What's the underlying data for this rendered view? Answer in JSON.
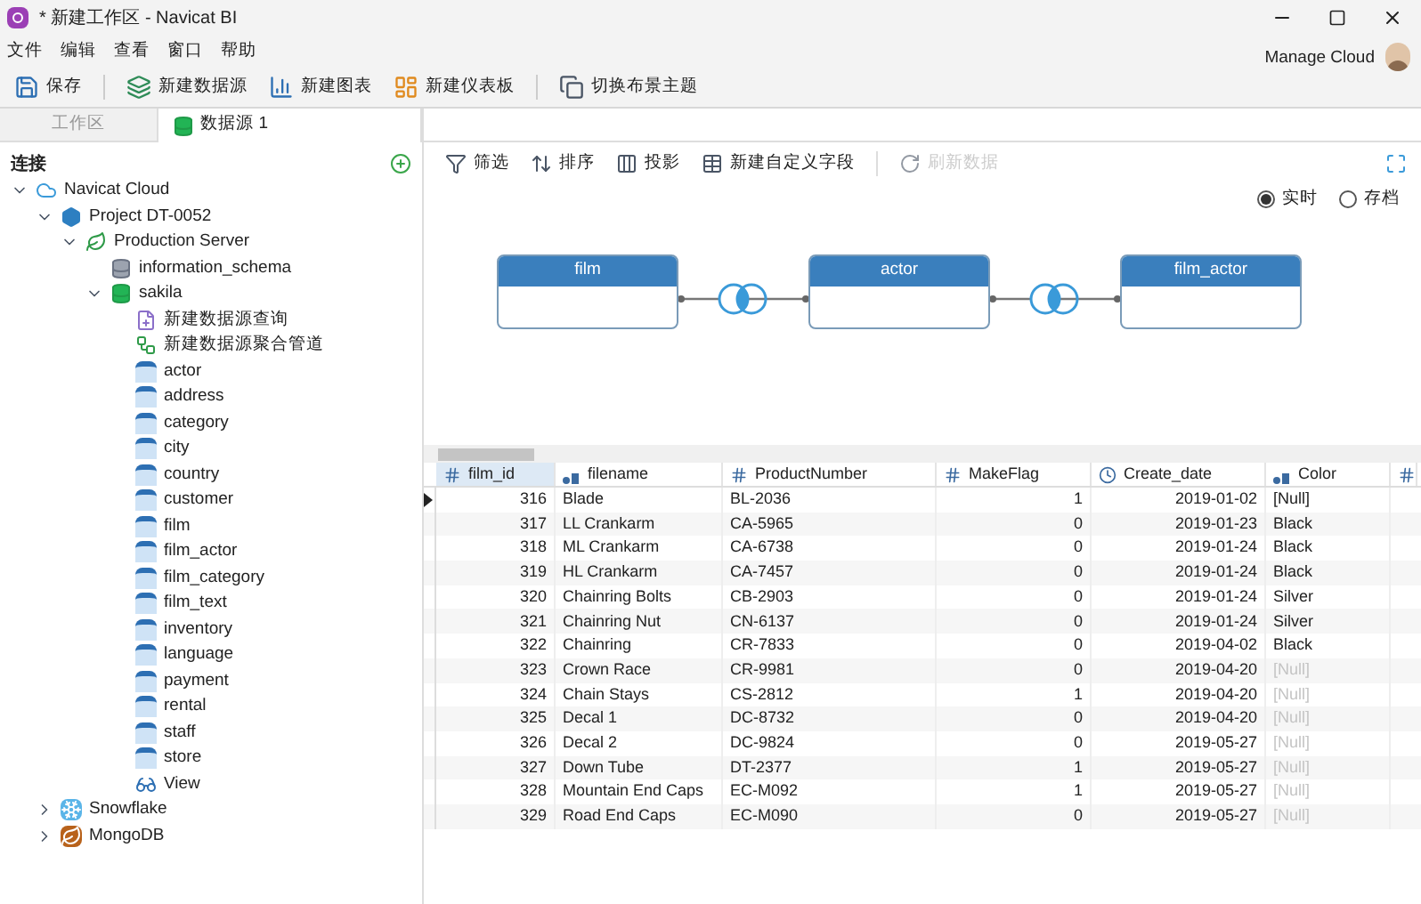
{
  "window": {
    "title": "* 新建工作区 - Navicat BI"
  },
  "menu": [
    "文件",
    "编辑",
    "查看",
    "窗口",
    "帮助"
  ],
  "account": {
    "label": "Manage Cloud"
  },
  "toolbar": [
    {
      "label": "保存",
      "kind": "save"
    },
    {
      "label": "新建数据源",
      "kind": "datasource"
    },
    {
      "label": "新建图表",
      "kind": "chart"
    },
    {
      "label": "新建仪表板",
      "kind": "dashboard"
    },
    {
      "label": "切换布景主题",
      "kind": "theme"
    }
  ],
  "tabs": [
    {
      "label": "工作区",
      "selected": false
    },
    {
      "label": "数据源 1",
      "selected": true
    }
  ],
  "sidebar": {
    "title": "连接",
    "tree": [
      {
        "label": "Navicat Cloud",
        "kind": "cloud",
        "expanded": true,
        "children": [
          {
            "label": "Project DT-0052",
            "kind": "project",
            "expanded": true,
            "children": [
              {
                "label": "Production Server",
                "kind": "server",
                "expanded": true,
                "children": [
                  {
                    "label": "information_schema",
                    "kind": "schema"
                  },
                  {
                    "label": "sakila",
                    "kind": "database",
                    "expanded": true,
                    "children": [
                      {
                        "label": "新建数据源查询",
                        "kind": "query"
                      },
                      {
                        "label": "新建数据源聚合管道",
                        "kind": "pipeline"
                      },
                      {
                        "label": "actor",
                        "kind": "table"
                      },
                      {
                        "label": "address",
                        "kind": "table"
                      },
                      {
                        "label": "category",
                        "kind": "table"
                      },
                      {
                        "label": "city",
                        "kind": "table"
                      },
                      {
                        "label": "country",
                        "kind": "table"
                      },
                      {
                        "label": "customer",
                        "kind": "table"
                      },
                      {
                        "label": "film",
                        "kind": "table"
                      },
                      {
                        "label": "film_actor",
                        "kind": "table"
                      },
                      {
                        "label": "film_category",
                        "kind": "table"
                      },
                      {
                        "label": "film_text",
                        "kind": "table"
                      },
                      {
                        "label": "inventory",
                        "kind": "table"
                      },
                      {
                        "label": "language",
                        "kind": "table"
                      },
                      {
                        "label": "payment",
                        "kind": "table"
                      },
                      {
                        "label": "rental",
                        "kind": "table"
                      },
                      {
                        "label": "staff",
                        "kind": "table"
                      },
                      {
                        "label": "store",
                        "kind": "table"
                      },
                      {
                        "label": "View",
                        "kind": "view"
                      }
                    ]
                  }
                ]
              }
            ]
          },
          {
            "label": "Snowflake",
            "kind": "snowflake",
            "expanded": false
          },
          {
            "label": "MongoDB",
            "kind": "mongodb",
            "expanded": false
          }
        ]
      }
    ]
  },
  "data_toolbar": [
    {
      "label": "筛选",
      "kind": "filter",
      "disabled": false
    },
    {
      "label": "排序",
      "kind": "sort",
      "disabled": false
    },
    {
      "label": "投影",
      "kind": "projection",
      "disabled": false
    },
    {
      "label": "新建自定义字段",
      "kind": "field",
      "disabled": false
    },
    {
      "label": "刷新数据",
      "kind": "refresh",
      "disabled": true
    }
  ],
  "mode": [
    {
      "label": "实时",
      "selected": true
    },
    {
      "label": "存档",
      "selected": false
    }
  ],
  "diagram": {
    "nodes": [
      "film",
      "actor",
      "film_actor"
    ]
  },
  "table": {
    "columns": [
      {
        "name": "film_id",
        "kind": "number"
      },
      {
        "name": "filename",
        "kind": "text"
      },
      {
        "name": "ProductNumber",
        "kind": "number"
      },
      {
        "name": "MakeFlag",
        "kind": "number"
      },
      {
        "name": "Create_date",
        "kind": "date"
      },
      {
        "name": "Color",
        "kind": "text"
      },
      {
        "kind": "number"
      }
    ],
    "rows": [
      {
        "selected": true,
        "dimmed": false,
        "cells": [
          "316",
          "Blade",
          "BL-2036",
          "1",
          "2019-01-02",
          "[Null]"
        ]
      },
      {
        "selected": false,
        "dimmed": false,
        "cells": [
          "317",
          "LL Crankarm",
          "CA-5965",
          "0",
          "2019-01-23",
          "Black"
        ]
      },
      {
        "selected": false,
        "dimmed": false,
        "cells": [
          "318",
          "ML Crankarm",
          "CA-6738",
          "0",
          "2019-01-24",
          "Black"
        ]
      },
      {
        "selected": false,
        "dimmed": false,
        "cells": [
          "319",
          "HL Crankarm",
          "CA-7457",
          "0",
          "2019-01-24",
          "Black"
        ]
      },
      {
        "selected": false,
        "dimmed": false,
        "cells": [
          "320",
          "Chainring Bolts",
          "CB-2903",
          "0",
          "2019-01-24",
          "Silver"
        ]
      },
      {
        "selected": false,
        "dimmed": false,
        "cells": [
          "321",
          "Chainring Nut",
          "CN-6137",
          "0",
          "2019-01-24",
          "Silver"
        ]
      },
      {
        "selected": false,
        "dimmed": false,
        "cells": [
          "322",
          "Chainring",
          "CR-7833",
          "0",
          "2019-04-02",
          "Black"
        ]
      },
      {
        "selected": false,
        "dimmed": true,
        "cells": [
          "323",
          "Crown Race",
          "CR-9981",
          "0",
          "2019-04-20",
          "[Null]"
        ]
      },
      {
        "selected": false,
        "dimmed": true,
        "cells": [
          "324",
          "Chain Stays",
          "CS-2812",
          "1",
          "2019-04-20",
          "[Null]"
        ]
      },
      {
        "selected": false,
        "dimmed": true,
        "cells": [
          "325",
          "Decal 1",
          "DC-8732",
          "0",
          "2019-04-20",
          "[Null]"
        ]
      },
      {
        "selected": false,
        "dimmed": true,
        "cells": [
          "326",
          "Decal 2",
          "DC-9824",
          "0",
          "2019-05-27",
          "[Null]"
        ]
      },
      {
        "selected": false,
        "dimmed": true,
        "cells": [
          "327",
          "Down Tube",
          "DT-2377",
          "1",
          "2019-05-27",
          "[Null]"
        ]
      },
      {
        "selected": false,
        "dimmed": true,
        "cells": [
          "328",
          "Mountain End Caps",
          "EC-M092",
          "1",
          "2019-05-27",
          "[Null]"
        ]
      },
      {
        "selected": false,
        "dimmed": true,
        "cells": [
          "329",
          "Road End Caps",
          "EC-M090",
          "0",
          "2019-05-27",
          "[Null]"
        ]
      }
    ]
  }
}
